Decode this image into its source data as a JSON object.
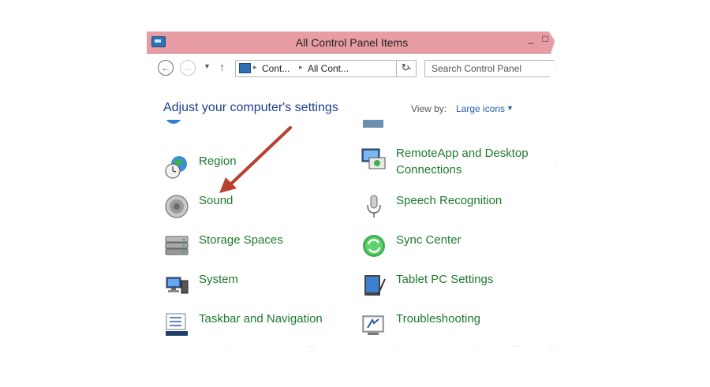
{
  "window": {
    "title": "All Control Panel Items",
    "controls": [
      "_",
      "□"
    ]
  },
  "nav": {
    "back": "←",
    "forward": "→",
    "recent": "▼",
    "up": "↑",
    "address": {
      "sep1": "▸",
      "crumb1": "Cont...",
      "sep2": "▸",
      "crumb2": "All Cont...",
      "dropdown": "⌄"
    },
    "refresh": "↻",
    "search_placeholder": "Search Control Panel"
  },
  "header": {
    "heading": "Adjust your computer's settings",
    "view_by_label": "View by:",
    "view_by_value": "Large icons",
    "view_by_arrow": "▼"
  },
  "items": {
    "left": [
      {
        "label": "Region",
        "icon": "globe-clock-icon"
      },
      {
        "label": "Sound",
        "icon": "speaker-icon"
      },
      {
        "label": "Storage Spaces",
        "icon": "storage-drives-icon"
      },
      {
        "label": "System",
        "icon": "computer-icon"
      },
      {
        "label": "Taskbar and Navigation",
        "icon": "taskbar-icon"
      }
    ],
    "right": [
      {
        "label": "RemoteApp and Desktop Connections",
        "icon": "remoteapp-icon"
      },
      {
        "label": "Speech Recognition",
        "icon": "microphone-icon"
      },
      {
        "label": "Sync Center",
        "icon": "sync-icon"
      },
      {
        "label": "Tablet PC Settings",
        "icon": "tablet-icon"
      },
      {
        "label": "Troubleshooting",
        "icon": "troubleshoot-icon"
      }
    ]
  },
  "colors": {
    "titlebar": "#e89ca4",
    "item_text": "#1d7a2e",
    "heading_text": "#1e3f8a",
    "annotation_arrow": "#b8412f"
  }
}
